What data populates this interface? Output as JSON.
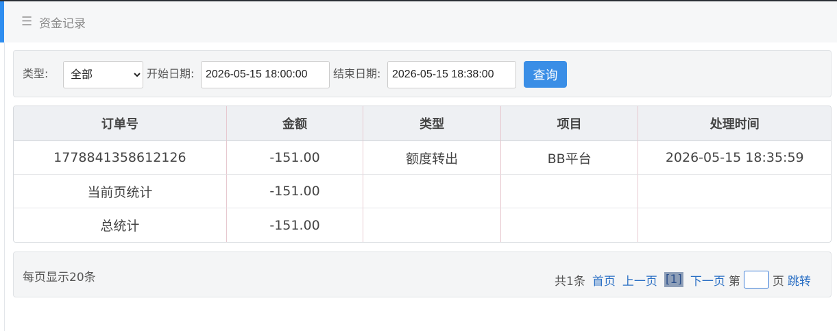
{
  "header": {
    "menu_icon": "menu-icon",
    "title": "资金记录"
  },
  "filter": {
    "type_label": "类型:",
    "type_selected": "全部",
    "start_label": "开始日期:",
    "start_value": "2026-05-15 18:00:00",
    "end_label": "结束日期:",
    "end_value": "2026-05-15 18:38:00",
    "query_label": "查询"
  },
  "table": {
    "columns": [
      "订单号",
      "金额",
      "类型",
      "项目",
      "处理时间"
    ],
    "rows": [
      [
        "1778841358612126",
        "-151.00",
        "额度转出",
        "BB平台",
        "2026-05-15 18:35:59"
      ],
      [
        "当前页统计",
        "-151.00",
        "",
        "",
        ""
      ],
      [
        "总统计",
        "-151.00",
        "",
        "",
        ""
      ]
    ]
  },
  "pager": {
    "per_page": "每页显示20条",
    "total": "共1条",
    "first": "首页",
    "prev": "上一页",
    "current": "[1]",
    "next": "下一页",
    "goto_prefix": "第",
    "goto_suffix": "页",
    "jump": "跳转"
  },
  "colors": {
    "accent": "#2f8ef0",
    "button": "#3a8ee6",
    "link": "#2a6fc4"
  }
}
